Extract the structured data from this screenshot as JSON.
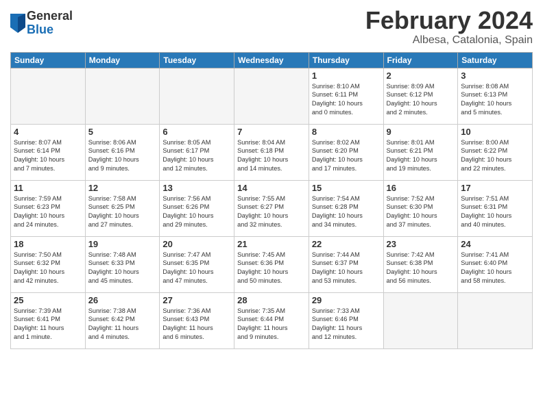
{
  "header": {
    "logo_general": "General",
    "logo_blue": "Blue",
    "title": "February 2024",
    "location": "Albesa, Catalonia, Spain"
  },
  "calendar": {
    "days_of_week": [
      "Sunday",
      "Monday",
      "Tuesday",
      "Wednesday",
      "Thursday",
      "Friday",
      "Saturday"
    ],
    "weeks": [
      [
        {
          "day": "",
          "info": ""
        },
        {
          "day": "",
          "info": ""
        },
        {
          "day": "",
          "info": ""
        },
        {
          "day": "",
          "info": ""
        },
        {
          "day": "1",
          "info": "Sunrise: 8:10 AM\nSunset: 6:11 PM\nDaylight: 10 hours\nand 0 minutes."
        },
        {
          "day": "2",
          "info": "Sunrise: 8:09 AM\nSunset: 6:12 PM\nDaylight: 10 hours\nand 2 minutes."
        },
        {
          "day": "3",
          "info": "Sunrise: 8:08 AM\nSunset: 6:13 PM\nDaylight: 10 hours\nand 5 minutes."
        }
      ],
      [
        {
          "day": "4",
          "info": "Sunrise: 8:07 AM\nSunset: 6:14 PM\nDaylight: 10 hours\nand 7 minutes."
        },
        {
          "day": "5",
          "info": "Sunrise: 8:06 AM\nSunset: 6:16 PM\nDaylight: 10 hours\nand 9 minutes."
        },
        {
          "day": "6",
          "info": "Sunrise: 8:05 AM\nSunset: 6:17 PM\nDaylight: 10 hours\nand 12 minutes."
        },
        {
          "day": "7",
          "info": "Sunrise: 8:04 AM\nSunset: 6:18 PM\nDaylight: 10 hours\nand 14 minutes."
        },
        {
          "day": "8",
          "info": "Sunrise: 8:02 AM\nSunset: 6:20 PM\nDaylight: 10 hours\nand 17 minutes."
        },
        {
          "day": "9",
          "info": "Sunrise: 8:01 AM\nSunset: 6:21 PM\nDaylight: 10 hours\nand 19 minutes."
        },
        {
          "day": "10",
          "info": "Sunrise: 8:00 AM\nSunset: 6:22 PM\nDaylight: 10 hours\nand 22 minutes."
        }
      ],
      [
        {
          "day": "11",
          "info": "Sunrise: 7:59 AM\nSunset: 6:23 PM\nDaylight: 10 hours\nand 24 minutes."
        },
        {
          "day": "12",
          "info": "Sunrise: 7:58 AM\nSunset: 6:25 PM\nDaylight: 10 hours\nand 27 minutes."
        },
        {
          "day": "13",
          "info": "Sunrise: 7:56 AM\nSunset: 6:26 PM\nDaylight: 10 hours\nand 29 minutes."
        },
        {
          "day": "14",
          "info": "Sunrise: 7:55 AM\nSunset: 6:27 PM\nDaylight: 10 hours\nand 32 minutes."
        },
        {
          "day": "15",
          "info": "Sunrise: 7:54 AM\nSunset: 6:28 PM\nDaylight: 10 hours\nand 34 minutes."
        },
        {
          "day": "16",
          "info": "Sunrise: 7:52 AM\nSunset: 6:30 PM\nDaylight: 10 hours\nand 37 minutes."
        },
        {
          "day": "17",
          "info": "Sunrise: 7:51 AM\nSunset: 6:31 PM\nDaylight: 10 hours\nand 40 minutes."
        }
      ],
      [
        {
          "day": "18",
          "info": "Sunrise: 7:50 AM\nSunset: 6:32 PM\nDaylight: 10 hours\nand 42 minutes."
        },
        {
          "day": "19",
          "info": "Sunrise: 7:48 AM\nSunset: 6:33 PM\nDaylight: 10 hours\nand 45 minutes."
        },
        {
          "day": "20",
          "info": "Sunrise: 7:47 AM\nSunset: 6:35 PM\nDaylight: 10 hours\nand 47 minutes."
        },
        {
          "day": "21",
          "info": "Sunrise: 7:45 AM\nSunset: 6:36 PM\nDaylight: 10 hours\nand 50 minutes."
        },
        {
          "day": "22",
          "info": "Sunrise: 7:44 AM\nSunset: 6:37 PM\nDaylight: 10 hours\nand 53 minutes."
        },
        {
          "day": "23",
          "info": "Sunrise: 7:42 AM\nSunset: 6:38 PM\nDaylight: 10 hours\nand 56 minutes."
        },
        {
          "day": "24",
          "info": "Sunrise: 7:41 AM\nSunset: 6:40 PM\nDaylight: 10 hours\nand 58 minutes."
        }
      ],
      [
        {
          "day": "25",
          "info": "Sunrise: 7:39 AM\nSunset: 6:41 PM\nDaylight: 11 hours\nand 1 minute."
        },
        {
          "day": "26",
          "info": "Sunrise: 7:38 AM\nSunset: 6:42 PM\nDaylight: 11 hours\nand 4 minutes."
        },
        {
          "day": "27",
          "info": "Sunrise: 7:36 AM\nSunset: 6:43 PM\nDaylight: 11 hours\nand 6 minutes."
        },
        {
          "day": "28",
          "info": "Sunrise: 7:35 AM\nSunset: 6:44 PM\nDaylight: 11 hours\nand 9 minutes."
        },
        {
          "day": "29",
          "info": "Sunrise: 7:33 AM\nSunset: 6:46 PM\nDaylight: 11 hours\nand 12 minutes."
        },
        {
          "day": "",
          "info": ""
        },
        {
          "day": "",
          "info": ""
        }
      ]
    ]
  }
}
